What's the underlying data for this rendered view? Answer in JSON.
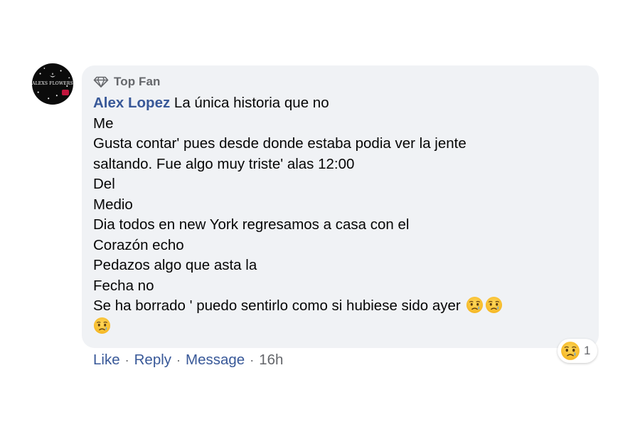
{
  "avatar": {
    "brand_text": "ALEXS FLOWERS",
    "tagline": "",
    "colors": {
      "background": "#0b0b0b",
      "accent": "#c0143c"
    }
  },
  "badge": {
    "icon": "diamond-icon",
    "label": "Top Fan"
  },
  "comment": {
    "author": "Alex Lopez",
    "text": " La única historia que no\nMe\nGusta contar' pues desde donde estaba podia ver la jente\nsaltando. Fue algo muy triste' alas 12:00\nDel\nMedio\nDia todos en new York regresamos a casa con el\nCorazón echo\nPedazos algo que asta la\nFecha no\nSe ha borrado ' puedo sentirlo como si hubiese sido ayer",
    "trailing_emojis": [
      "sad-tear-emoji",
      "sad-tear-emoji",
      "sad-tear-emoji"
    ]
  },
  "reaction": {
    "emoji": "sad-tear-emoji",
    "count": "1"
  },
  "actions": {
    "like": "Like",
    "reply": "Reply",
    "message": "Message",
    "separator": "·",
    "timestamp": "16h"
  },
  "colors": {
    "bubble_bg": "#f0f2f5",
    "link": "#385898",
    "secondary_text": "#65676b",
    "primary_text": "#050505"
  }
}
